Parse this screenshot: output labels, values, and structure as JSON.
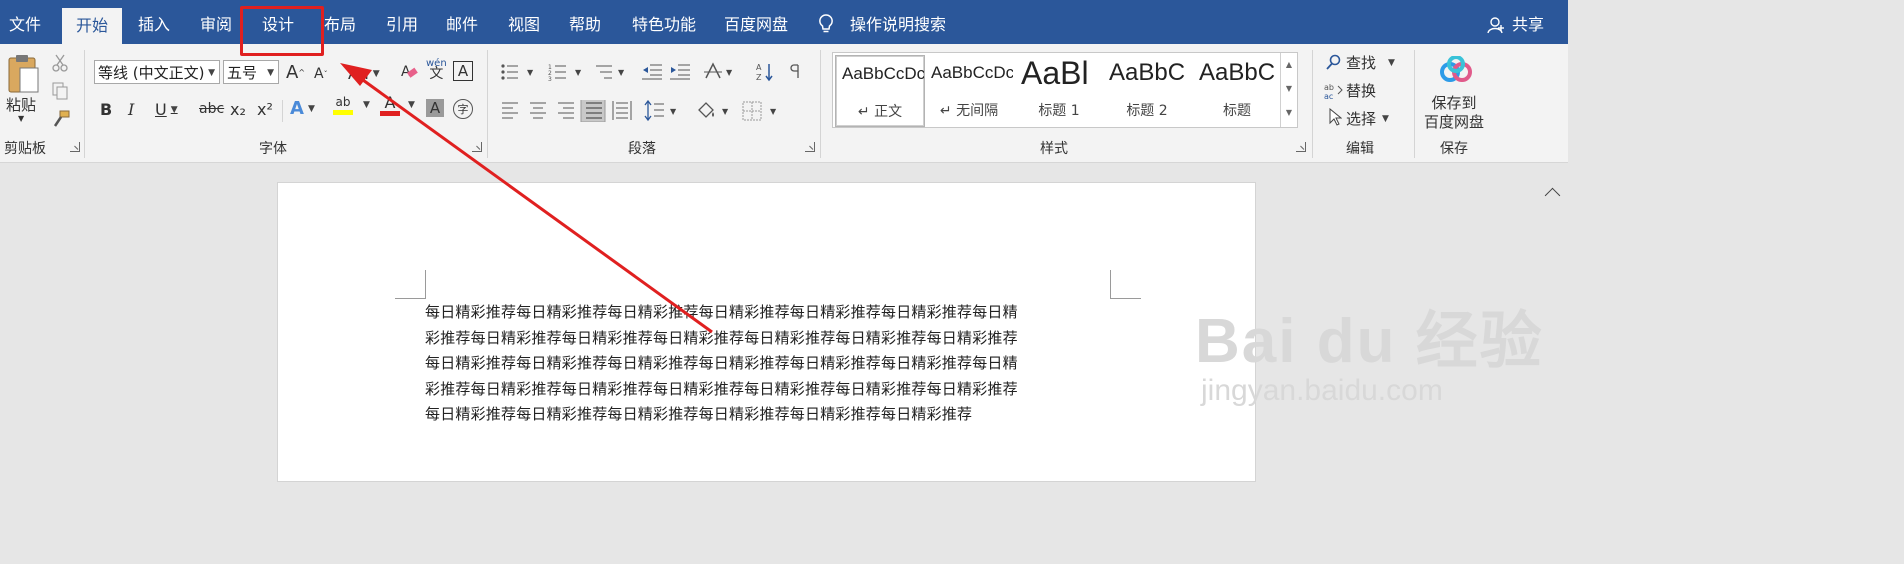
{
  "menubar": {
    "tabs": [
      "文件",
      "开始",
      "插入",
      "审阅",
      "设计",
      "布局",
      "引用",
      "邮件",
      "视图",
      "帮助",
      "特色功能",
      "百度网盘"
    ],
    "active_tab": "开始",
    "tell_me": "操作说明搜索",
    "share": "共享"
  },
  "ribbon": {
    "clipboard": {
      "paste": "粘贴",
      "label": "剪贴板"
    },
    "font": {
      "font_name": "等线 (中文正文)",
      "font_size": "五号",
      "grow": "A",
      "shrink": "A",
      "change_case": "Aa",
      "phonetic_top": "wén",
      "phonetic_bottom": "文",
      "char_border": "A",
      "bold": "B",
      "italic": "I",
      "underline": "U",
      "strike": "abc",
      "subscript": "x₂",
      "superscript": "x²",
      "text_effects": "A",
      "highlight": "ab",
      "font_color": "A",
      "char_shading": "A",
      "enclose": "字",
      "label": "字体"
    },
    "paragraph": {
      "label": "段落"
    },
    "styles": {
      "items": [
        {
          "sample": "AaBbCcDc",
          "name": "↵ 正文",
          "size": 17
        },
        {
          "sample": "AaBbCcDc",
          "name": "↵ 无间隔",
          "size": 17
        },
        {
          "sample": "AaBl",
          "name": "标题 1",
          "size": 32
        },
        {
          "sample": "AaBbC",
          "name": "标题 2",
          "size": 24
        },
        {
          "sample": "AaBbC",
          "name": "标题",
          "size": 24
        }
      ],
      "label": "样式"
    },
    "editing": {
      "find": "查找",
      "replace": "替换",
      "select": "选择",
      "label": "编辑"
    },
    "save": {
      "button": "保存到\n百度网盘",
      "line1": "保存到",
      "line2": "百度网盘",
      "label": "保存"
    }
  },
  "document": {
    "lines": [
      "每日精彩推荐每日精彩推荐每日精彩推荐每日精彩推荐每日精彩推荐每日精彩推荐每日精",
      "彩推荐每日精彩推荐每日精彩推荐每日精彩推荐每日精彩推荐每日精彩推荐每日精彩推荐",
      "每日精彩推荐每日精彩推荐每日精彩推荐每日精彩推荐每日精彩推荐每日精彩推荐每日精",
      "彩推荐每日精彩推荐每日精彩推荐每日精彩推荐每日精彩推荐每日精彩推荐每日精彩推荐",
      "每日精彩推荐每日精彩推荐每日精彩推荐每日精彩推荐每日精彩推荐每日精彩推荐"
    ]
  },
  "watermark": {
    "big": "Bai du 经验",
    "small": "jingyan.baidu.com"
  },
  "colors": {
    "word_blue": "#2b579a",
    "annotation_red": "#e02020"
  }
}
